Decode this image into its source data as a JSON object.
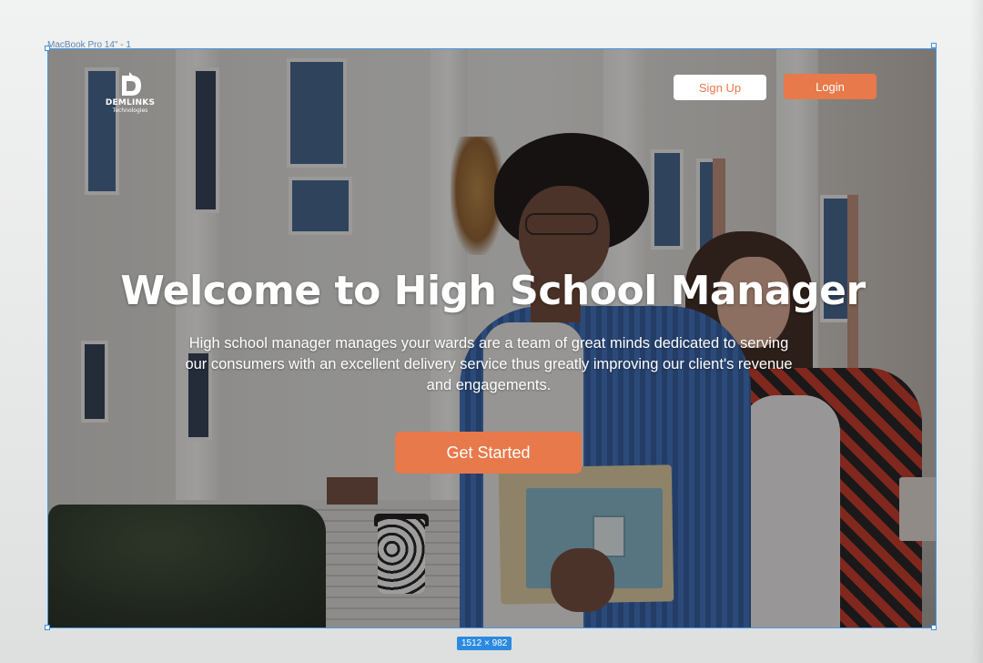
{
  "editor": {
    "frame_label": "MacBook Pro 14\" - 1",
    "frame_size": "1512 × 982"
  },
  "brand": {
    "name": "DEMLINKS",
    "sub": "Technologies",
    "icon": "demlinks-logo-icon"
  },
  "nav": {
    "signup_label": "Sign Up",
    "login_label": "Login"
  },
  "hero": {
    "title": "Welcome to High School Manager",
    "description": "High school manager manages your wards are a team of great minds dedicated to serving our consumers with an excellent delivery service thus greatly improving our client's revenue and engagements.",
    "cta_label": "Get Started"
  },
  "colors": {
    "accent": "#e8794a",
    "white": "#ffffff",
    "selection": "#4a9be6"
  }
}
